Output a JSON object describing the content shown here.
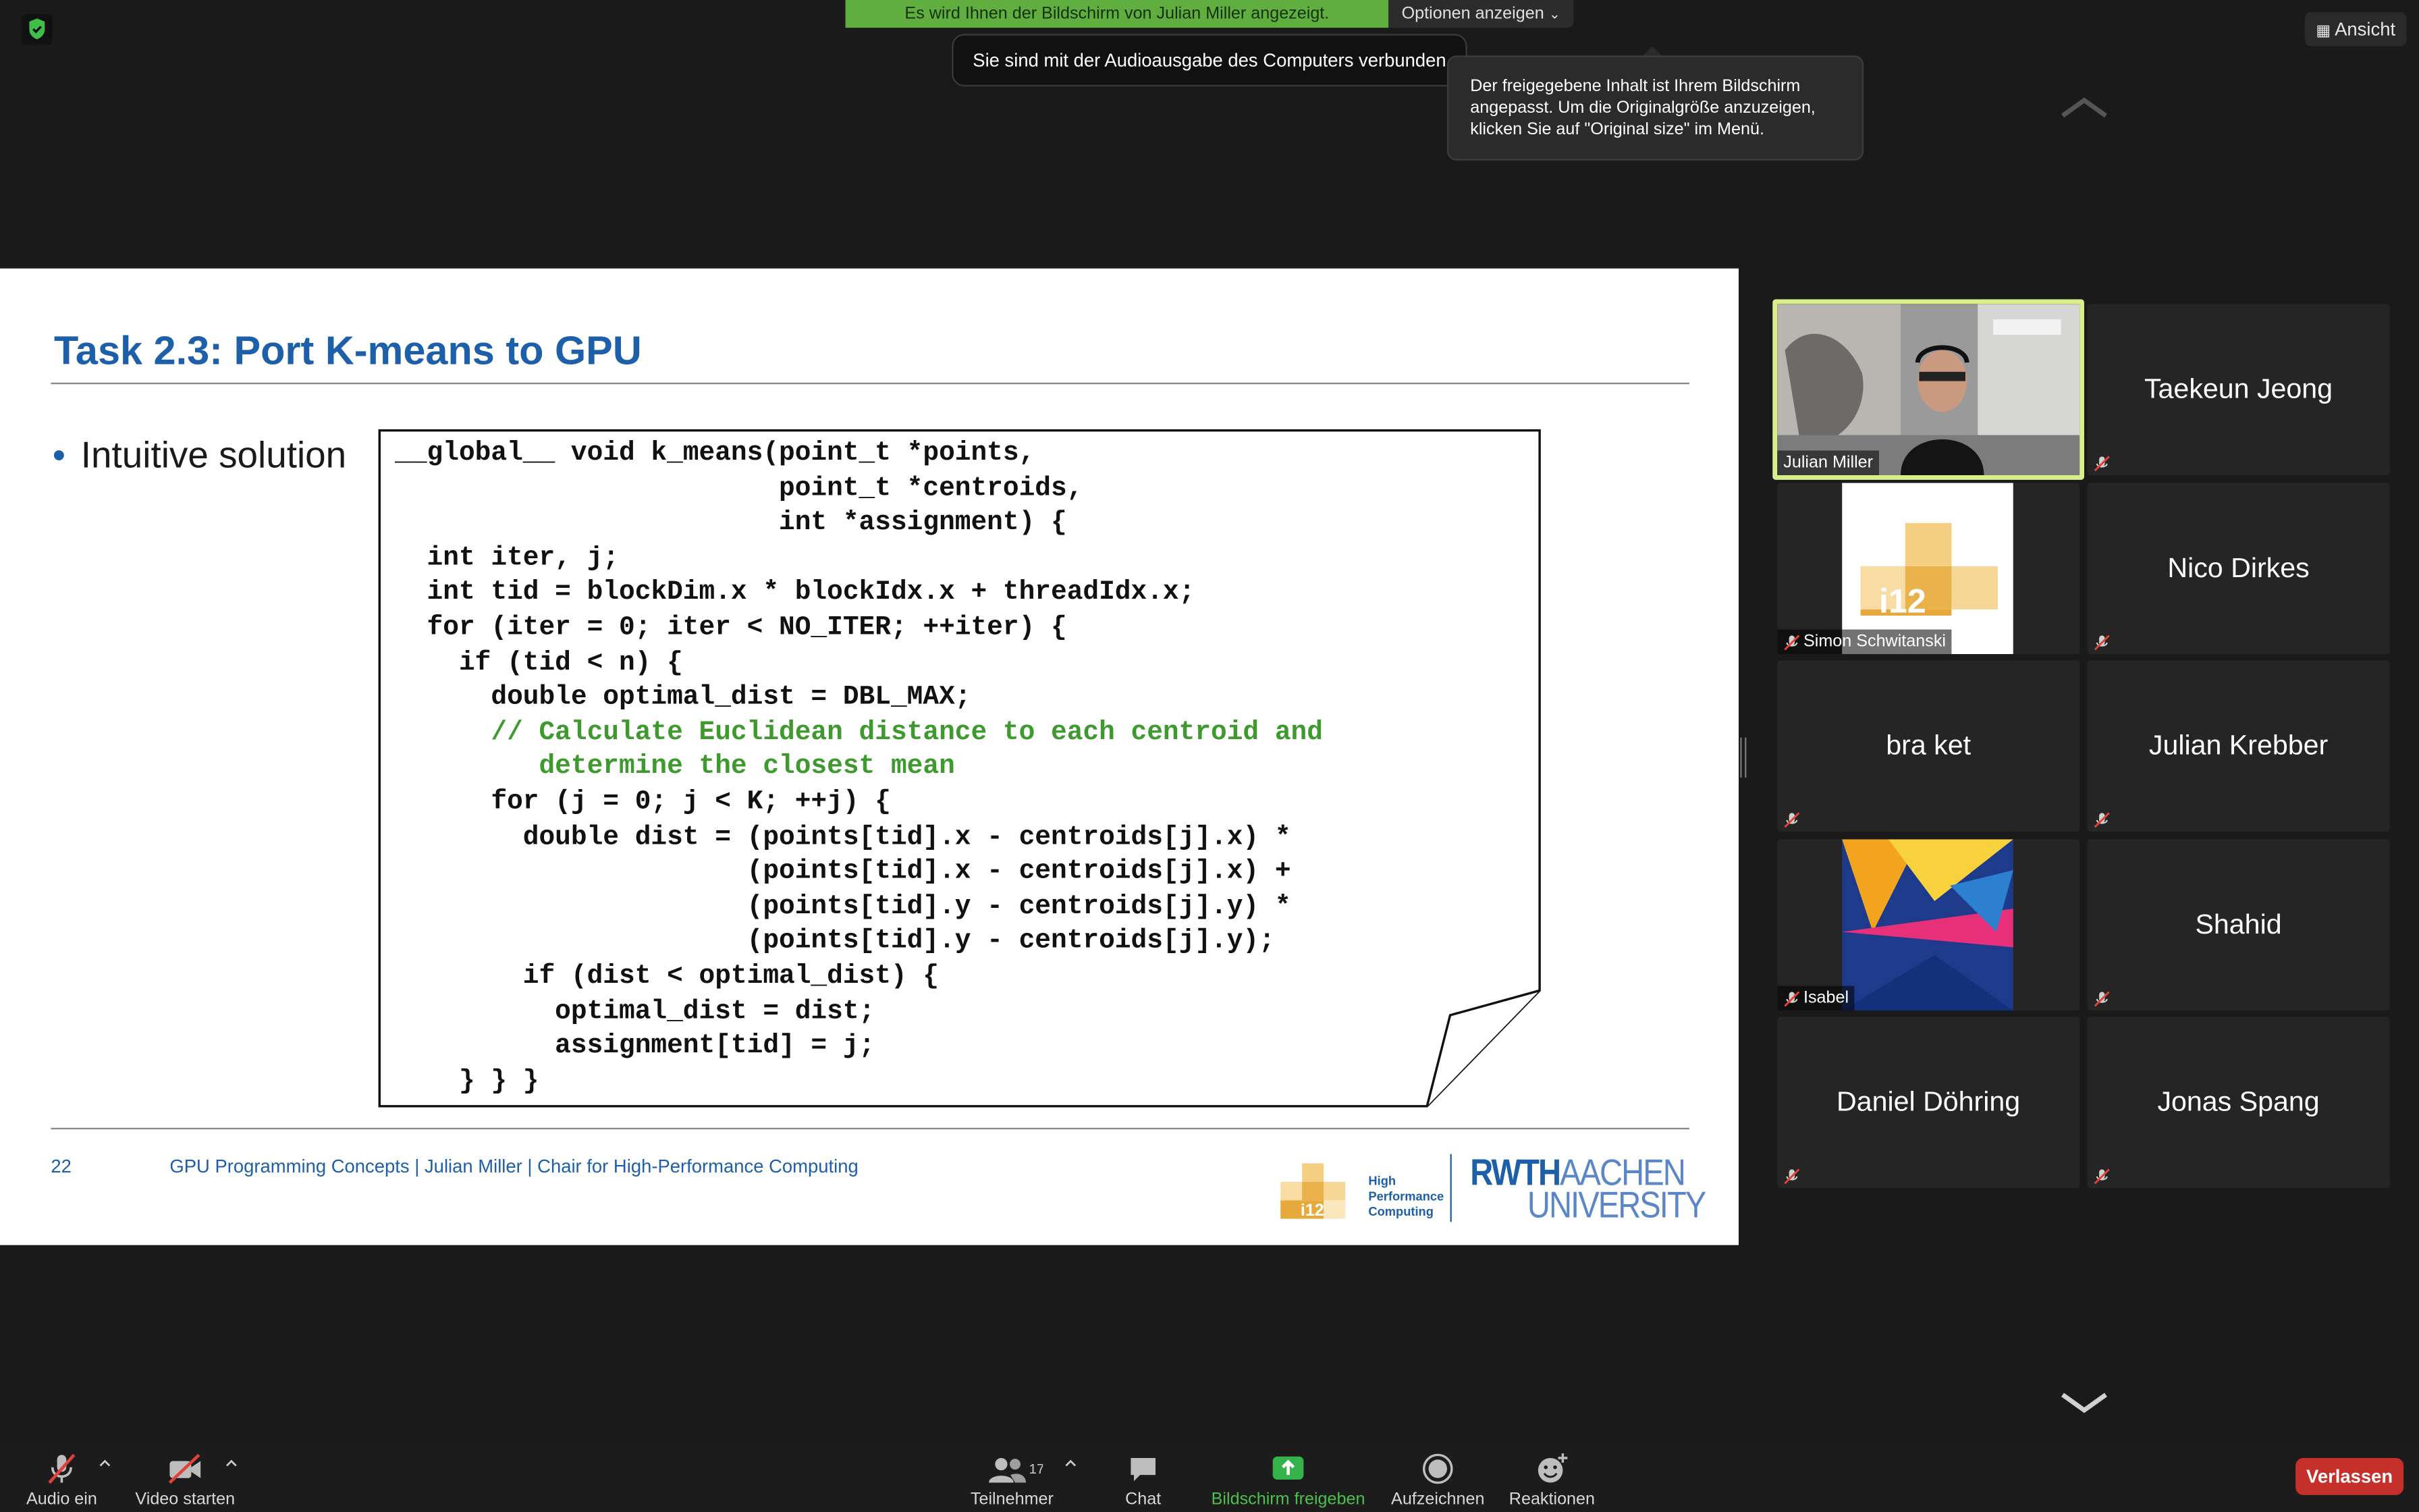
{
  "top": {
    "share_banner": "Es wird Ihnen der Bildschirm von Julian Miller angezeigt.",
    "options_label": "Optionen anzeigen",
    "audio_toast": "Sie sind mit der Audioausgabe des Computers verbunden",
    "fit_tooltip_lines": [
      "Der freigegebene Inhalt ist Ihrem Bildschirm",
      "angepasst. Um die Originalgröße anzuzeigen,",
      "klicken Sie auf \"Original size\" im Menü."
    ],
    "view_label": "Ansicht"
  },
  "slide": {
    "title": "Task 2.3: Port K-means to GPU",
    "bullet": "Intuitive solution",
    "code_lines": [
      "__global__ void k_means(point_t *points,",
      "                        point_t *centroids,",
      "                        int *assignment) {",
      "  int iter, j;",
      "  int tid = blockDim.x * blockIdx.x + threadIdx.x;",
      "  for (iter = 0; iter < NO_ITER; ++iter) {",
      "    if (tid < n) {",
      "      double optimal_dist = DBL_MAX;",
      "      // Calculate Euclidean distance to each centroid and",
      "         determine the closest mean",
      "      for (j = 0; j < K; ++j) {",
      "        double dist = (points[tid].x - centroids[j].x) *",
      "                      (points[tid].x - centroids[j].x) +",
      "                      (points[tid].y - centroids[j].y) *",
      "                      (points[tid].y - centroids[j].y);",
      "        if (dist < optimal_dist) {",
      "          optimal_dist = dist;",
      "          assignment[tid] = j;",
      "    } } }"
    ],
    "comment_line_indexes": [
      8,
      9
    ],
    "page_number": "22",
    "footer": "GPU Programming Concepts |  Julian Miller |  Chair for High-Performance Computing",
    "i12_text": "i12",
    "hpc_lines": [
      "High",
      "Performance",
      "Computing"
    ],
    "rwth_line1_bold": "RWTH",
    "rwth_line1_light": "AACHEN",
    "rwth_line2": "UNIVERSITY"
  },
  "participants": [
    {
      "name": "Julian Miller",
      "video": true,
      "active": true,
      "muted": false
    },
    {
      "name": "Taekeun Jeong",
      "video": false,
      "muted": true
    },
    {
      "name": "Simon Schwitanski",
      "video": "i12-logo",
      "muted": true
    },
    {
      "name": "Nico Dirkes",
      "video": false,
      "muted": true
    },
    {
      "name": "bra ket",
      "video": false,
      "muted": true
    },
    {
      "name": "Julian Krebber",
      "video": false,
      "muted": true
    },
    {
      "name": "Isabel",
      "video": "abstract-image",
      "muted": true
    },
    {
      "name": "Shahid",
      "video": false,
      "muted": true
    },
    {
      "name": "Daniel Döhring",
      "video": false,
      "muted": true
    },
    {
      "name": "Jonas Spang",
      "video": false,
      "muted": true
    }
  ],
  "toolbar": {
    "audio": "Audio ein",
    "video": "Video starten",
    "participants": "Teilnehmer",
    "participant_count": "17",
    "chat": "Chat",
    "share": "Bildschirm freigeben",
    "record": "Aufzeichnen",
    "reactions": "Reaktionen",
    "leave": "Verlassen"
  },
  "colors": {
    "share_green": "#5fae3f",
    "leave_red": "#c5302a",
    "slide_blue": "#1d5fa8",
    "code_comment": "#3e9a2e",
    "i12_orange": "#e9b24a",
    "active_speaker_border": "#d9f08a"
  }
}
